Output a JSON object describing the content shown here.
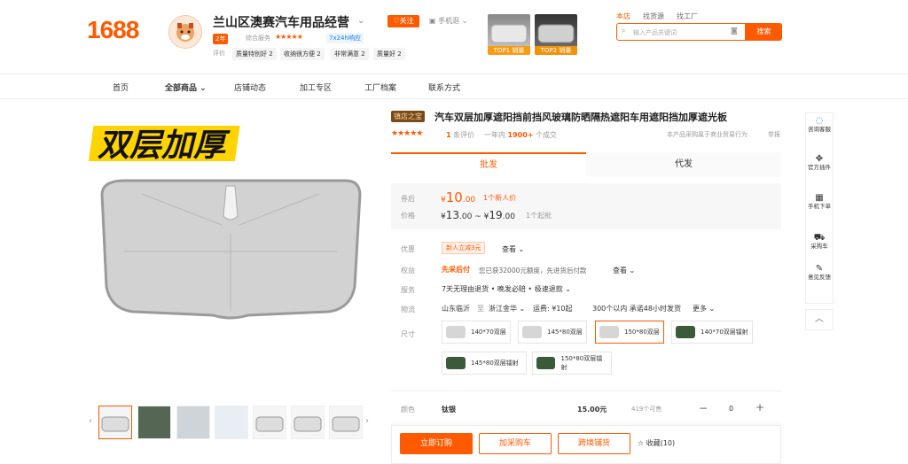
{
  "header": {
    "logo": "1688",
    "shop_name": "兰山区澳赛汽车用品经营",
    "follow": "关注",
    "mobile": "手机逛",
    "year_badge": "2年",
    "service_label": "综合服务",
    "service_stars": "★★★★★",
    "response": "7x24h响应",
    "eval_label": "评价",
    "tags": [
      "质量特别好 2",
      "收纳很方便 2",
      "非常满意 2",
      "质量好 2"
    ],
    "top_thumbs": [
      {
        "label": "TOP1 销量"
      },
      {
        "label": "TOP2 销量"
      }
    ],
    "search_tabs": [
      "本店",
      "找货源",
      "找工厂"
    ],
    "search_placeholder": "输入产品关键词",
    "search_button": "搜索"
  },
  "nav": [
    "首页",
    "全部商品",
    "店铺动态",
    "加工专区",
    "工厂档案",
    "联系方式"
  ],
  "gallery": {
    "main_text": "双层加厚"
  },
  "product": {
    "gold_tag": "镇店之宝",
    "title": "汽车双层加厚遮阳挡前挡风玻璃防晒隔热遮阳车用遮阳挡加厚遮光板",
    "stars": "★★★★★",
    "eval_count": "1",
    "eval_suffix": "条评价",
    "sold_prefix": "一年内",
    "sold_count": "1900+",
    "sold_suffix": "个成交",
    "declare": "本产品采购属于商业贸易行为",
    "report": "举报",
    "tab_wholesale": "批发",
    "tab_dropship": "代发",
    "coupon_label": "券后",
    "coupon_currency": "¥",
    "coupon_int": "10",
    "coupon_dec": ".00",
    "coupon_note": "1个新人价",
    "price_label": "价格",
    "price_low_int": "13",
    "price_low_dec": ".00",
    "price_high_int": "19",
    "price_high_dec": ".00",
    "min_order": "1个起批",
    "promo_label": "优惠",
    "promo_badge": "新人立减3元",
    "promo_view": "查看",
    "rights_label": "权益",
    "rights_strong": "先采后付",
    "rights_text": "您已获32000元额度，先进货后付款",
    "rights_view": "查看",
    "service_label": "服务",
    "service_text": "7天无理由退货 • 晚发必赔 • 极速退款",
    "logistics_label": "物流",
    "logistics_from": "山东临沂",
    "logistics_to": "至",
    "logistics_dest": "浙江金华",
    "logistics_fee": "运费: ¥10起",
    "logistics_promise": "300个以内 承诺48小时发货",
    "logistics_more": "更多",
    "size_label": "尺寸",
    "sizes": [
      "140*70双层",
      "145*80双层",
      "150*80双层",
      "140*70双层镭射",
      "145*80双层镭射",
      "150*80双层镭射"
    ],
    "color_label": "颜色",
    "color_value": "钛银",
    "color_price": "15.00元",
    "stock": "419个可售",
    "qty": "0",
    "buy_now": "立即订购",
    "add_cart": "加采购车",
    "cross_border": "跨境铺货",
    "favorite": "收藏(10)"
  },
  "sidebar": [
    "咨询客服",
    "官方插件",
    "手机下单",
    "采购车",
    "意见反馈"
  ],
  "colors": {
    "accent": "#ff5a00"
  }
}
